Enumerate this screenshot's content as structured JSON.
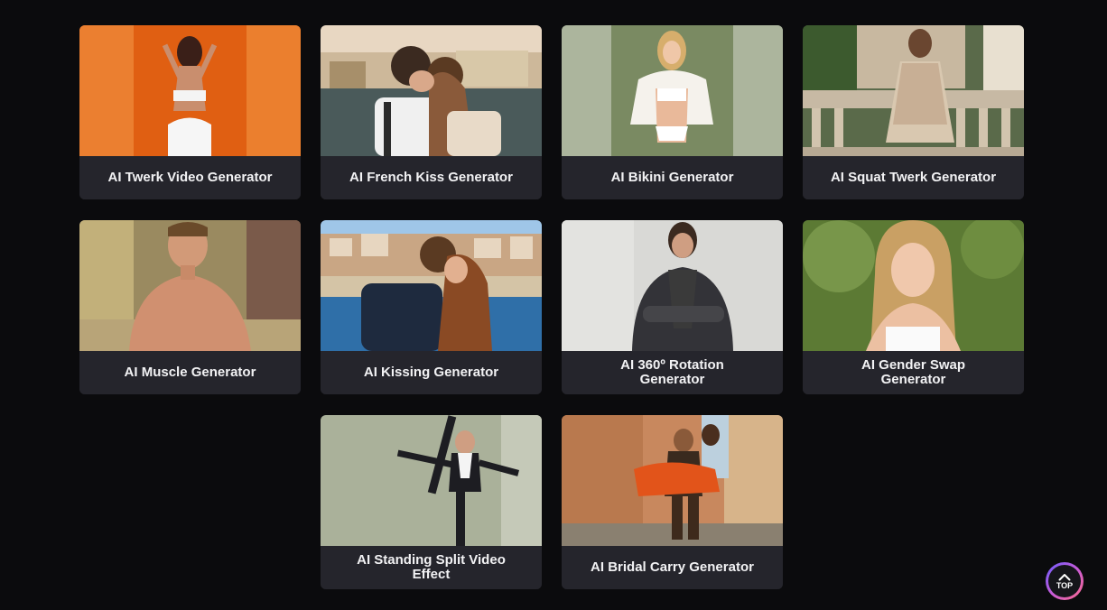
{
  "cards": [
    {
      "label": "AI Twerk Video Generator",
      "image": "woman-orange-backdrop-back-view"
    },
    {
      "label": "AI French Kiss Generator",
      "image": "couple-kissing-by-river"
    },
    {
      "label": "AI Bikini Generator",
      "image": "woman-white-bikini-field"
    },
    {
      "label": "AI Squat Twerk Generator",
      "image": "woman-floral-dress-balustrade"
    },
    {
      "label": "AI Muscle Generator",
      "image": "shirtless-man-park"
    },
    {
      "label": "AI Kissing Generator",
      "image": "couple-kissing-beach"
    },
    {
      "label": "AI 360º Rotation Generator",
      "image": "man-denim-jacket-studio"
    },
    {
      "label": "AI Gender Swap Generator",
      "image": "woman-blonde-garden"
    },
    {
      "label": "AI Standing Split Video Effect",
      "image": "man-suit-standing-split"
    },
    {
      "label": "AI Bridal Carry Generator",
      "image": "man-carrying-woman-street"
    }
  ],
  "top_button": {
    "label": "TOP",
    "icon": "chevron-up-icon"
  },
  "colors": {
    "background": "#0b0b0d",
    "card": "#24242b",
    "text": "#f2f2f4"
  }
}
